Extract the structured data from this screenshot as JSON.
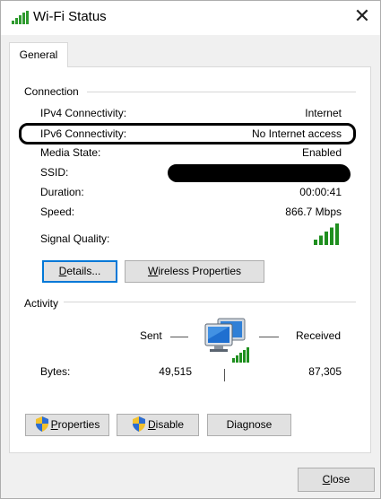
{
  "window": {
    "title": "Wi-Fi Status",
    "close_glyph": "✕"
  },
  "tabs": [
    {
      "label": "General"
    }
  ],
  "connection": {
    "heading": "Connection",
    "rows": [
      {
        "label": "IPv4 Connectivity:",
        "value": "Internet"
      },
      {
        "label": "IPv6 Connectivity:",
        "value": "No Internet access"
      },
      {
        "label": "Media State:",
        "value": "Enabled"
      },
      {
        "label": "SSID:",
        "value": ""
      },
      {
        "label": "Duration:",
        "value": "00:00:41"
      },
      {
        "label": "Speed:",
        "value": "866.7 Mbps"
      }
    ],
    "signal_label": "Signal Quality:",
    "signal_bars": 5,
    "signal_bars_max": 5
  },
  "buttons": {
    "details": {
      "mnemonic": "D",
      "rest": "etails..."
    },
    "wireless": {
      "mnemonic": "W",
      "rest": "ireless Properties"
    }
  },
  "activity": {
    "heading": "Activity",
    "sent_label": "Sent",
    "received_label": "Received",
    "bytes_label": "Bytes:",
    "bytes_sent": "49,515",
    "bytes_received": "87,305"
  },
  "bottom_buttons": {
    "properties": {
      "mnemonic": "P",
      "rest": "roperties"
    },
    "disable": {
      "mnemonic": "D",
      "rest": "isable"
    },
    "diagnose": {
      "label_before": "Dia",
      "mnemonic": "g",
      "label_after": "nose"
    }
  },
  "footer": {
    "close": {
      "mnemonic": "C",
      "rest": "lose"
    }
  },
  "colors": {
    "signal_green": "#1f8f1f",
    "accent_blue": "#0078d7"
  }
}
